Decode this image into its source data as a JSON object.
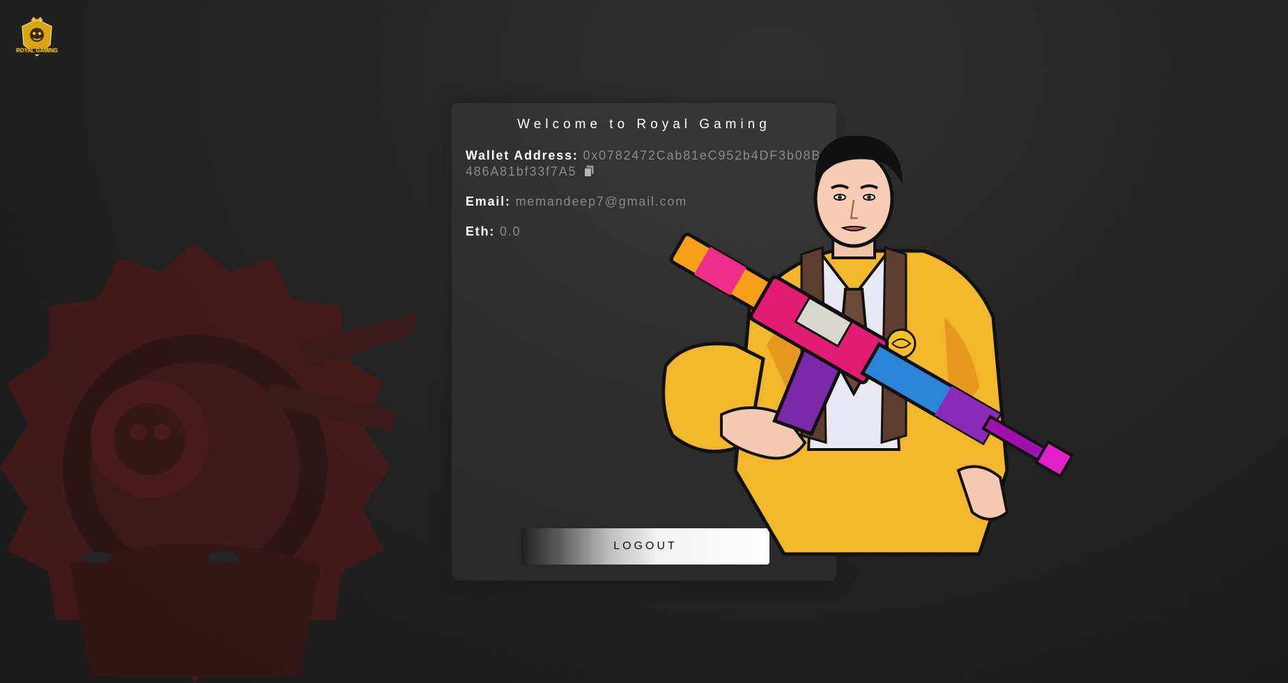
{
  "brand": {
    "logo_text": "ROYAL GAMING",
    "logo_color": "#f1c232"
  },
  "card": {
    "title": "Welcome to Royal Gaming",
    "wallet_label": "Wallet Address:",
    "wallet_value": "0x0782472Cab81eC952b4DF3b08B486A81bf33f7A5",
    "email_label": "Email:",
    "email_value": "memandeep7@gmail.com",
    "eth_label": "Eth:",
    "eth_value": "0.0",
    "logout_label": "LOGOUT"
  },
  "icons": {
    "copy": "copy-icon",
    "logo": "royal-gaming-logo-icon",
    "background": "skull-gear-emblem-icon",
    "character": "gamer-character-illustration"
  },
  "colors": {
    "background": "#242424",
    "emblem": "#5a1414",
    "label": "#ffffff",
    "value": "#8a8a8a"
  }
}
